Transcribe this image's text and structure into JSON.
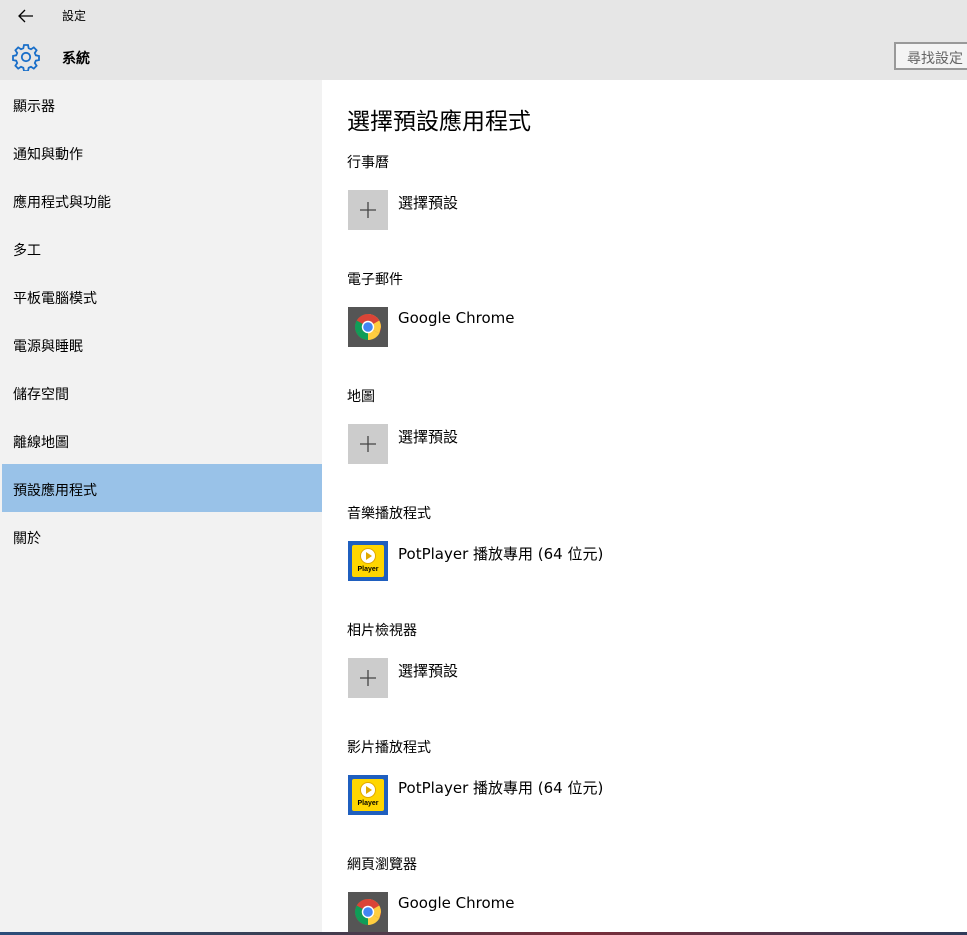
{
  "window": {
    "title": "設定"
  },
  "header": {
    "title": "系統",
    "search_placeholder": "尋找設定"
  },
  "sidebar": {
    "items": [
      {
        "label": "顯示器"
      },
      {
        "label": "通知與動作"
      },
      {
        "label": "應用程式與功能"
      },
      {
        "label": "多工"
      },
      {
        "label": "平板電腦模式"
      },
      {
        "label": "電源與睡眠"
      },
      {
        "label": "儲存空間"
      },
      {
        "label": "離線地圖"
      },
      {
        "label": "預設應用程式",
        "selected": true
      },
      {
        "label": "關於"
      }
    ]
  },
  "main": {
    "title": "選擇預設應用程式",
    "sections": [
      {
        "label": "行事曆",
        "app": "選擇預設",
        "icon": "plus-icon"
      },
      {
        "label": "電子郵件",
        "app": "Google Chrome",
        "icon": "chrome-icon"
      },
      {
        "label": "地圖",
        "app": "選擇預設",
        "icon": "plus-icon"
      },
      {
        "label": "音樂播放程式",
        "app": "PotPlayer 播放專用 (64 位元)",
        "icon": "potplayer-icon",
        "icon_text": "Player"
      },
      {
        "label": "相片檢視器",
        "app": "選擇預設",
        "icon": "plus-icon"
      },
      {
        "label": "影片播放程式",
        "app": "PotPlayer 播放專用 (64 位元)",
        "icon": "potplayer-icon",
        "icon_text": "Player"
      },
      {
        "label": "網頁瀏覽器",
        "app": "Google Chrome",
        "icon": "chrome-icon"
      }
    ]
  },
  "colors": {
    "chrome_bar": "#e6e6e6",
    "sidebar_bg": "#f2f2f2",
    "selected_bg": "#99c2e8",
    "tile_gray": "#cccccc",
    "potplayer_blue": "#1f5fbf",
    "potplayer_yellow": "#ffd600"
  }
}
